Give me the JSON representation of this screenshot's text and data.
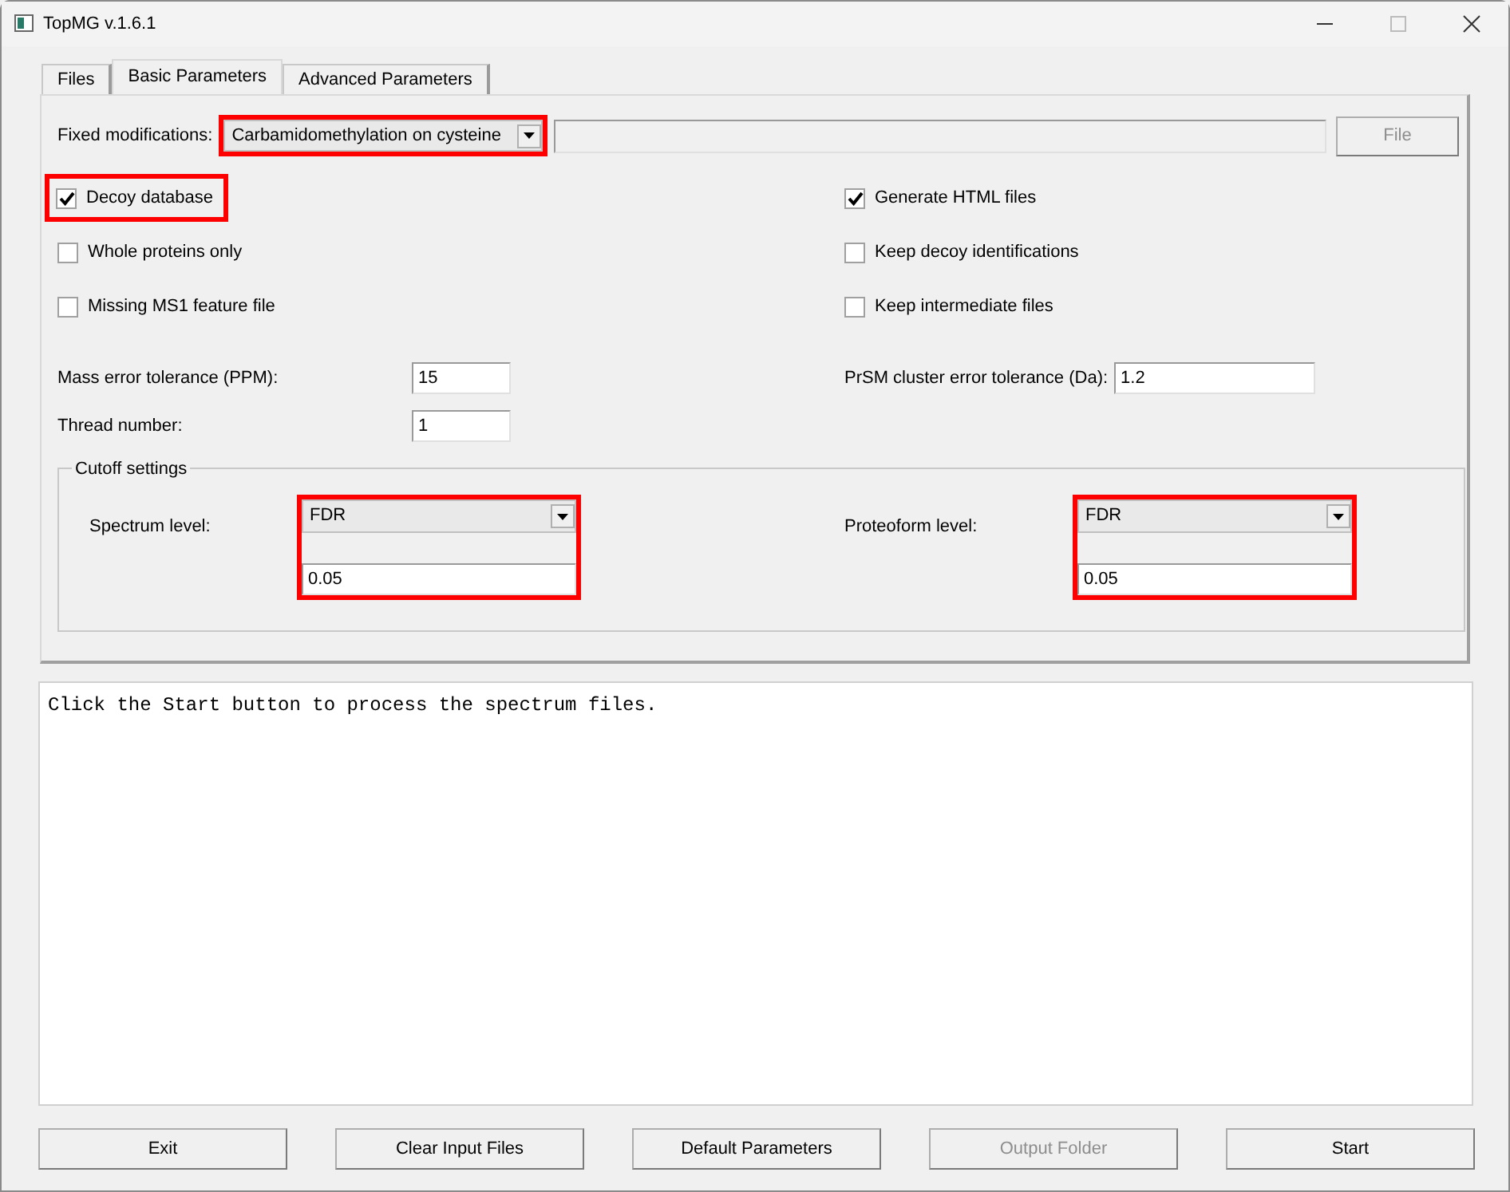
{
  "window": {
    "title": "TopMG v.1.6.1"
  },
  "tabs": [
    {
      "label": "Files",
      "selected": false
    },
    {
      "label": "Basic Parameters",
      "selected": true
    },
    {
      "label": "Advanced Parameters",
      "selected": false
    }
  ],
  "fixed_modifications": {
    "label": "Fixed modifications:",
    "value": "Carbamidomethylation on cysteine",
    "highlighted": true
  },
  "file_button": {
    "label": "File",
    "disabled": true
  },
  "options": [
    {
      "label": "Decoy database",
      "checked": true,
      "highlighted": true
    },
    {
      "label": "Generate HTML files",
      "checked": true,
      "highlighted": false
    },
    {
      "label": "Whole proteins only",
      "checked": false,
      "highlighted": false
    },
    {
      "label": "Keep decoy identifications",
      "checked": false,
      "highlighted": false
    },
    {
      "label": "Missing MS1 feature file",
      "checked": false,
      "highlighted": false
    },
    {
      "label": "Keep intermediate files",
      "checked": false,
      "highlighted": false
    }
  ],
  "parameters": [
    {
      "label": "Mass error tolerance (PPM):",
      "value": "15"
    },
    {
      "label": "PrSM cluster error tolerance (Da):",
      "value": "1.2"
    },
    {
      "label": "Thread number:",
      "value": "1"
    }
  ],
  "cutoff": {
    "title": "Cutoff settings",
    "levels": [
      {
        "label": "Spectrum level:",
        "method": "FDR",
        "value": "0.05",
        "highlighted": true
      },
      {
        "label": "Proteoform level:",
        "method": "FDR",
        "value": "0.05",
        "highlighted": true
      }
    ]
  },
  "log": {
    "text": "Click the Start button to process the spectrum files."
  },
  "buttons": [
    {
      "label": "Exit",
      "disabled": false
    },
    {
      "label": "Clear Input Files",
      "disabled": false
    },
    {
      "label": "Default Parameters",
      "disabled": false
    },
    {
      "label": "Output Folder",
      "disabled": true
    },
    {
      "label": "Start",
      "disabled": false
    }
  ]
}
